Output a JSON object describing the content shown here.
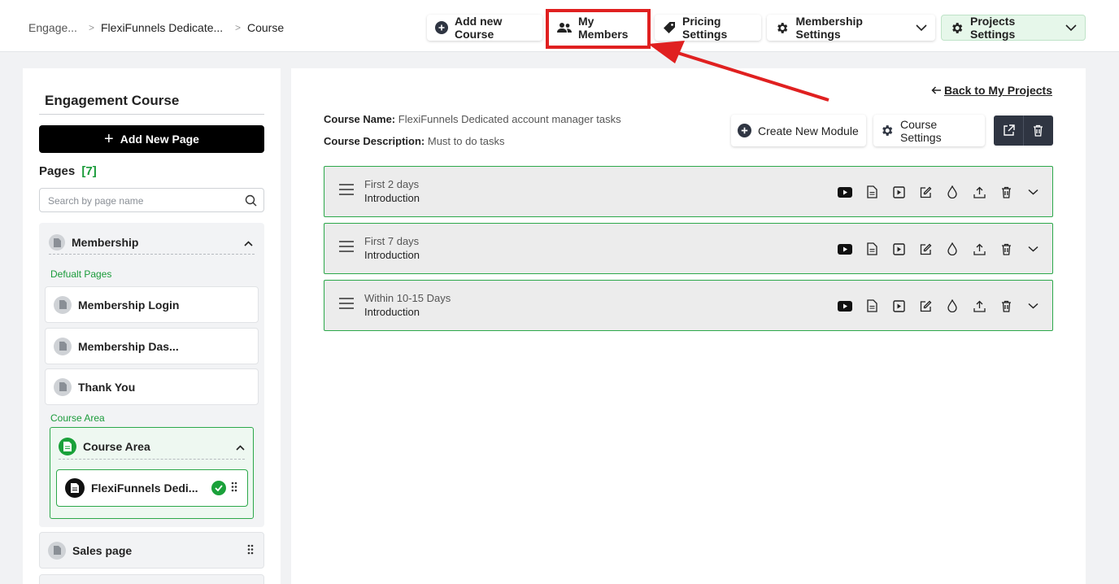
{
  "breadcrumb": {
    "items": [
      "Engage...",
      "FlexiFunnels Dedicate...",
      "Course"
    ],
    "separator": ">"
  },
  "toolbar": {
    "add_course": "Add new Course",
    "my_members": "My Members",
    "pricing": "Pricing Settings",
    "membership_settings": "Membership Settings",
    "projects_settings": "Projects Settings"
  },
  "sidebar": {
    "title": "Engagement Course",
    "add_page": "Add New Page",
    "pages_label": "Pages",
    "pages_count": "[7]",
    "search_placeholder": "Search by page name",
    "membership_group": {
      "label": "Membership",
      "default_label": "Defualt Pages",
      "pages": [
        "Membership Login",
        "Membership Das...",
        "Thank You"
      ],
      "course_area_label": "Course Area",
      "course_area": {
        "label": "Course Area",
        "item": "FlexiFunnels Dedi..."
      }
    },
    "sales_page": "Sales page"
  },
  "main": {
    "back_link": "Back to My Projects",
    "course_name_label": "Course Name:",
    "course_name": "FlexiFunnels Dedicated account manager tasks",
    "course_desc_label": "Course Description:",
    "course_desc": "Must to do tasks",
    "create_module": "Create New Module",
    "course_settings": "Course Settings",
    "modules": [
      {
        "subtitle": "First 2 days",
        "title": "Introduction"
      },
      {
        "subtitle": "First 7 days",
        "title": "Introduction"
      },
      {
        "subtitle": "Within 10-15 Days",
        "title": "Introduction"
      }
    ]
  },
  "colors": {
    "accent_green": "#1aa13a",
    "annotation_red": "#e02020",
    "dark_button": "#2f3542"
  }
}
